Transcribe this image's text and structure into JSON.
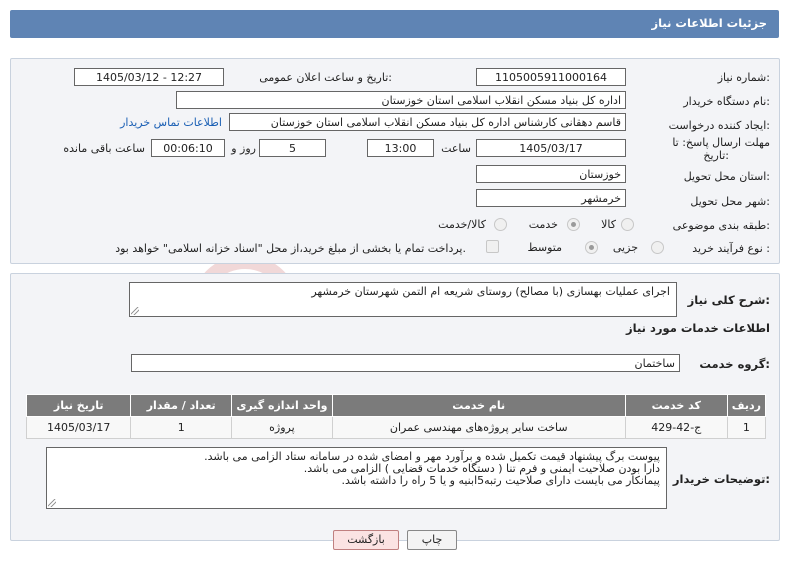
{
  "header": {
    "title": "جزئیات اطلاعات نیاز"
  },
  "form": {
    "need_number": {
      "label": "شماره نیاز:",
      "value": "1105005911000164"
    },
    "announce": {
      "label": "تاریخ و ساعت اعلان عمومی:",
      "value": "1405/03/12 - 12:27"
    },
    "buyer_org": {
      "label": "نام دستگاه خریدار:",
      "value": "اداره کل بنیاد مسکن انقلاب اسلامی استان خوزستان"
    },
    "requester": {
      "label": "ایجاد کننده درخواست:",
      "value": "قاسم دهقانی کارشناس اداره کل بنیاد مسکن انقلاب اسلامی استان خوزستان",
      "contact_link": "اطلاعات تماس خریدار"
    },
    "deadline": {
      "label_line1": "مهلت ارسال پاسخ: تا",
      "label_line2": "تاریخ:",
      "date": "1405/03/17",
      "time_label": "ساعت",
      "time": "13:00",
      "days": "5",
      "days_label": "روز و",
      "remaining": "00:06:10",
      "remaining_label": "ساعت باقی مانده"
    },
    "province": {
      "label": "استان محل تحویل:",
      "value": "خوزستان"
    },
    "city": {
      "label": "شهر محل تحویل:",
      "value": "خرمشهر"
    },
    "category": {
      "label": "طبقه بندی موضوعی:",
      "options": [
        "کالا",
        "خدمت",
        "کالا/خدمت"
      ],
      "selected": "خدمت"
    },
    "process": {
      "label": "نوع فرآیند خرید :",
      "options": [
        "جزیی",
        "متوسط"
      ],
      "selected": "متوسط",
      "payment_note": "پرداخت تمام یا بخشی از مبلغ خرید،از محل \"اسناد خزانه اسلامی\" خواهد بود."
    }
  },
  "summary": {
    "label": "شرح کلی نیاز:",
    "value": "اجرای عملیات بهسازی (با مصالح) روستای شریعه ام التمن شهرستان خرمشهر"
  },
  "services": {
    "section_title": "اطلاعات خدمات مورد نیاز",
    "group_label": "گروه خدمت:",
    "group_value": "ساختمان",
    "columns": [
      "ردیف",
      "کد خدمت",
      "نام خدمت",
      "واحد اندازه گیری",
      "تعداد / مقدار",
      "تاریخ نیاز"
    ],
    "rows": [
      {
        "row": "1",
        "code": "ج-42-429",
        "name": "ساخت سایر پروژه‌های مهندسی عمران",
        "unit": "پروژه",
        "qty": "1",
        "date": "1405/03/17"
      }
    ]
  },
  "buyer_notes": {
    "label": "توضیحات خریدار:",
    "lines": [
      "پیوست برگ پیشنهاد قیمت تکمیل شده و  برآورد مهر و امضای شده در سامانه ستاد الزامی می باشد.",
      "دارا بودن صلاحیت ایمنی و فرم تنا ( دستگاه خدمات قضایی ) الزامی می باشد.",
      "پیمانکار می بایست دارای صلاحیت رتبه5ابنیه و یا 5 راه را داشته باشد."
    ]
  },
  "buttons": {
    "print": "چاپ",
    "back": "بازگشت"
  },
  "watermark": {
    "text": "AriaTender.net",
    "color": "#e8c8c8"
  }
}
